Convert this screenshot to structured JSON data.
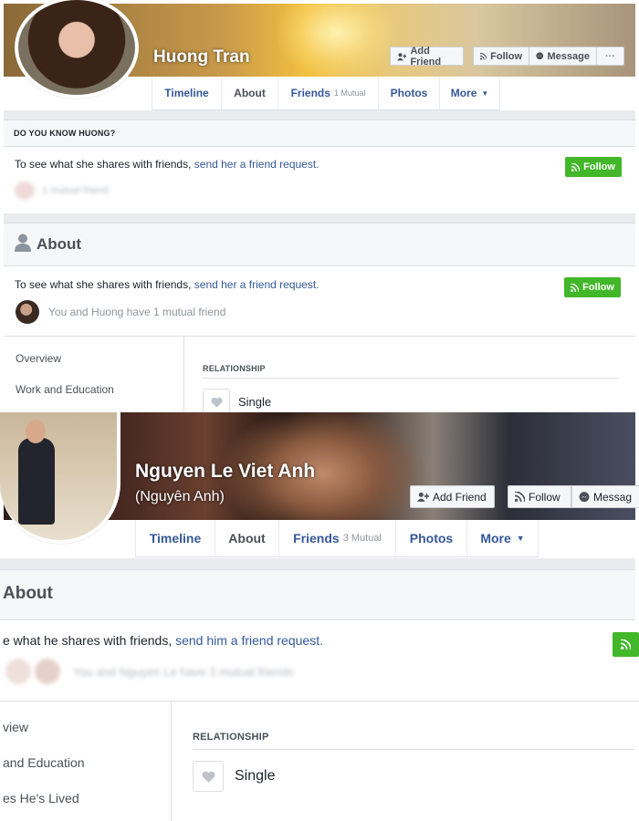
{
  "profile1": {
    "name": "Huong Tran",
    "cover_buttons": {
      "add_friend": "Add Friend",
      "follow": "Follow",
      "message": "Message",
      "more": "···"
    },
    "tabs": [
      {
        "label": "Timeline"
      },
      {
        "label": "About"
      },
      {
        "label": "Friends",
        "sub": "1 Mutual"
      },
      {
        "label": "Photos"
      },
      {
        "label": "More"
      }
    ],
    "know_header": "DO YOU KNOW HUONG?",
    "know_text": "To see what she shares with friends, ",
    "know_link": "send her a friend request.",
    "follow_label": "Follow",
    "blurred_text": "1 mutual friend",
    "about_title": "About",
    "about_text": "To see what she shares with friends, ",
    "about_link": "send her a friend request.",
    "mutual_text": "You and Huong have 1 mutual friend",
    "nav": [
      "Overview",
      "Work and Education"
    ],
    "relationship_header": "RELATIONSHIP",
    "relationship_value": "Single"
  },
  "profile2": {
    "name": "Nguyen Le Viet Anh",
    "alt_name": "(Nguyên Anh)",
    "cover_buttons": {
      "add_friend": "Add Friend",
      "follow": "Follow",
      "message": "Messag"
    },
    "tabs": [
      {
        "label": "Timeline"
      },
      {
        "label": "About"
      },
      {
        "label": "Friends",
        "sub": "3 Mutual"
      },
      {
        "label": "Photos"
      },
      {
        "label": "More"
      }
    ],
    "about_title": "About",
    "about_text": "e what he shares with friends, ",
    "about_link": "send him a friend request.",
    "blurred_text": "You and Nguyen Le have 3 mutual friends",
    "nav": [
      "view",
      "and Education",
      "es He's Lived"
    ],
    "relationship_header": "RELATIONSHIP",
    "relationship_value": "Single"
  },
  "colors": {
    "link": "#365899",
    "green": "#42b72a",
    "border": "#dddfe2",
    "bg_gray": "#e9ebee"
  },
  "icons": [
    "add-friend-icon",
    "follow-rss-icon",
    "messenger-icon",
    "more-dots-icon",
    "dropdown-caret-icon",
    "person-icon",
    "heart-icon"
  ]
}
